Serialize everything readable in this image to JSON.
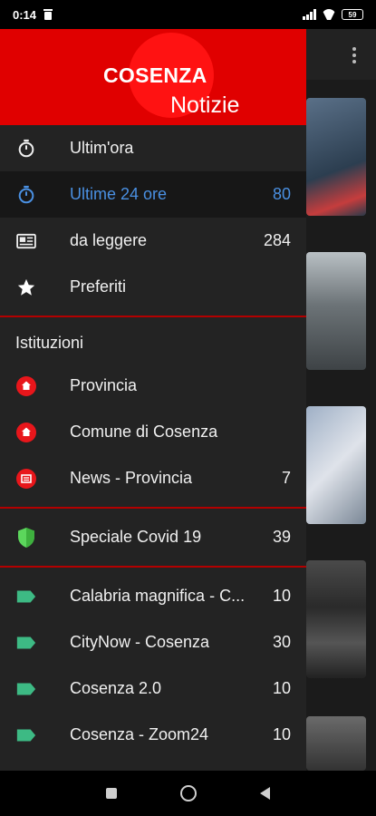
{
  "status_bar": {
    "time": "0:14",
    "battery": "59"
  },
  "header": {
    "brand_top": "COSENZA",
    "brand_bottom": "Notizie"
  },
  "menu_main": [
    {
      "label": "Ultim'ora",
      "count": "",
      "icon": "stopwatch-icon",
      "active": false
    },
    {
      "label": "Ultime 24 ore",
      "count": "80",
      "icon": "stopwatch-icon",
      "active": true
    },
    {
      "label": "da leggere",
      "count": "284",
      "icon": "newspaper-icon",
      "active": false
    },
    {
      "label": "Preferiti",
      "count": "",
      "icon": "star-icon",
      "active": false
    }
  ],
  "institutions": {
    "title": "Istituzioni",
    "items": [
      {
        "label": "Provincia",
        "count": "",
        "icon": "home-red-icon"
      },
      {
        "label": "Comune di Cosenza",
        "count": "",
        "icon": "home-red-icon"
      },
      {
        "label": "News - Provincia",
        "count": "7",
        "icon": "news-red-icon"
      }
    ]
  },
  "special": {
    "label": "Speciale Covid 19",
    "count": "39",
    "icon": "shield-icon"
  },
  "sources": [
    {
      "label": "Calabria magnifica - C...",
      "count": "10",
      "icon": "tag-icon"
    },
    {
      "label": "CityNow - Cosenza",
      "count": "30",
      "icon": "tag-icon"
    },
    {
      "label": "Cosenza 2.0",
      "count": "10",
      "icon": "tag-icon"
    },
    {
      "label": "Cosenza - Zoom24",
      "count": "10",
      "icon": "tag-icon"
    }
  ],
  "colors": {
    "accent": "#e00000",
    "active": "#4a90e2",
    "tag": "#3dba84",
    "shield": "#5cd65c"
  }
}
